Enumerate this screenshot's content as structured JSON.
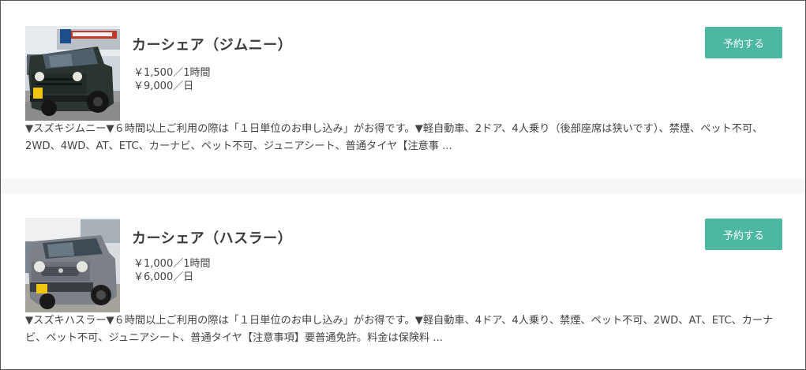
{
  "listings": [
    {
      "title": "カーシェア（ジムニー）",
      "price_hour": "￥1,500／1時間",
      "price_day": "￥9,000／日",
      "reserve_label": "予約する",
      "description": "▼スズキジムニー▼６時間以上ご利用の際は「１日単位のお申し込み」がお得です。▼軽自動車、2ドア、4人乗り（後部座席は狭いです）、禁煙、ペット不可、2WD、4WD、AT、ETC、カーナビ、ペット不可、ジュニアシート、普通タイヤ【注意事 ...",
      "car_color": "#2b3530"
    },
    {
      "title": "カーシェア（ハスラー）",
      "price_hour": "￥1,000／1時間",
      "price_day": "￥6,000／日",
      "reserve_label": "予約する",
      "description": "▼スズキハスラー▼６時間以上ご利用の際は「１日単位のお申し込み」がお得です。▼軽自動車、4ドア、4人乗り、禁煙、ペット不可、2WD、AT、ETC、カーナビ、ペット不可、ジュニアシート、普通タイヤ【注意事項】要普通免許。料金は保険料 ...",
      "car_color": "#7c8087"
    }
  ],
  "colors": {
    "accent": "#4db8a2",
    "separator": "#f5f6f7"
  }
}
